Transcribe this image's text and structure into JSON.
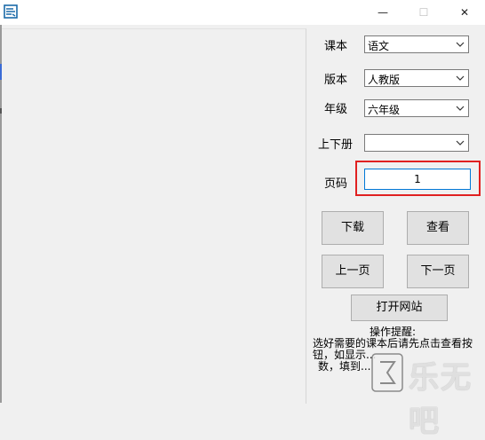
{
  "window": {
    "minimize_glyph": "—",
    "maximize_glyph": "☐",
    "close_glyph": "✕"
  },
  "form": {
    "textbook_label": "课本",
    "textbook_value": "语文",
    "edition_label": "版本",
    "edition_value": "人教版",
    "grade_label": "年级",
    "grade_value": "六年级",
    "volume_label": "上下册",
    "volume_value": "",
    "page_label": "页码",
    "page_value": "1"
  },
  "buttons": {
    "download": "下载",
    "view": "查看",
    "prev_page": "上一页",
    "next_page": "下一页",
    "open_site": "打开网站"
  },
  "notes": {
    "title": "操作提醒:",
    "line1": "选好需要的课本后请先点击查看按",
    "line2": "钮，如显示...",
    "line3": "数，填到..."
  },
  "watermark": {
    "text": "乐无吧"
  },
  "colors": {
    "highlight_border": "#e02020",
    "focus_border": "#0078d7",
    "button_bg": "#e1e1e1"
  },
  "icons": {
    "app": "app-icon",
    "dropdown": "chevron-down-icon"
  }
}
